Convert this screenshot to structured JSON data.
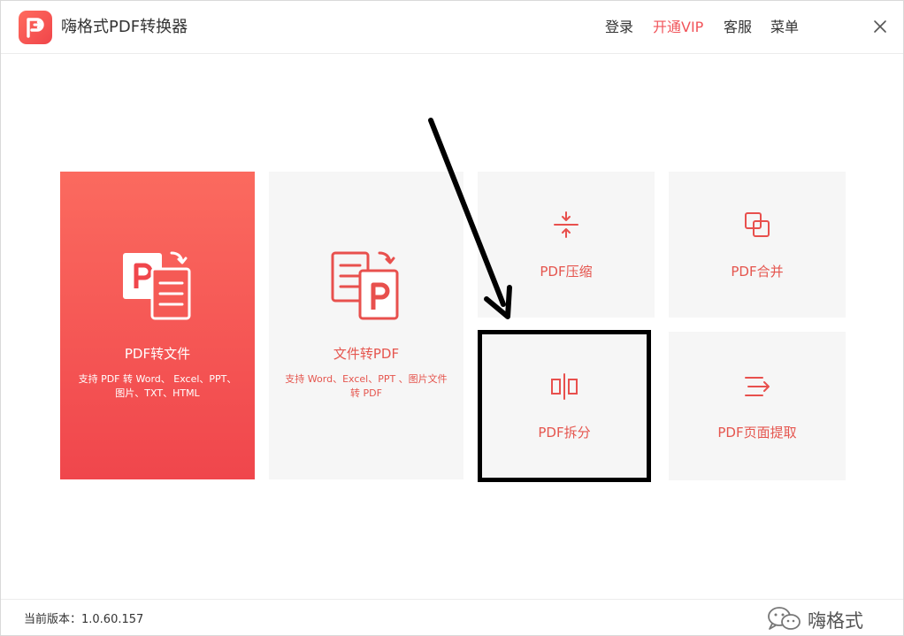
{
  "app": {
    "title": "嗨格式PDF转换器"
  },
  "header": {
    "menu": [
      {
        "label": "登录"
      },
      {
        "label": "开通VIP"
      },
      {
        "label": "客服"
      },
      {
        "label": "菜单"
      }
    ]
  },
  "cards": {
    "pdf_to_file": {
      "label": "PDF转文件",
      "desc": "支持 PDF 转 Word、 Excel、PPT、图片、TXT、HTML"
    },
    "file_to_pdf": {
      "label": "文件转PDF",
      "desc": "支持 Word、Excel、PPT 、图片文件转 PDF"
    },
    "compress": {
      "label": "PDF压缩"
    },
    "merge": {
      "label": "PDF合并"
    },
    "split": {
      "label": "PDF拆分"
    },
    "extract": {
      "label": "PDF页面提取"
    }
  },
  "footer": {
    "version": "当前版本：1.0.60.157",
    "watermark": "嗨格式"
  },
  "colors": {
    "accent": "#f1545a",
    "card_bg": "#f6f6f6"
  }
}
